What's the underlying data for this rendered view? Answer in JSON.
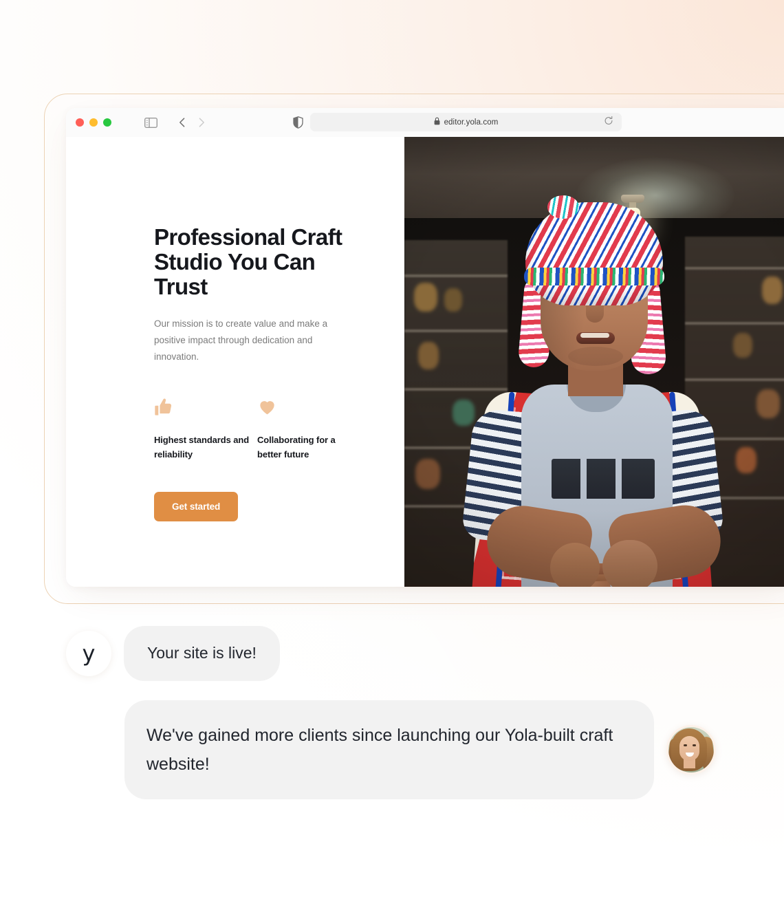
{
  "browser": {
    "traffic_lights": [
      "close",
      "minimize",
      "maximize"
    ],
    "sidebar_icon": "sidebar-toggle-icon",
    "back_icon": "chevron-left-icon",
    "forward_icon": "chevron-right-icon",
    "shield_icon": "shield-icon",
    "lock_icon": "lock-icon",
    "url": "editor.yola.com",
    "reload_icon": "reload-icon"
  },
  "hero": {
    "title": "Professional Craft Studio You Can Trust",
    "subtitle": "Our mission is to create value and make a positive impact through dedication and innovation.",
    "features": [
      {
        "icon": "thumbs-up-icon",
        "label": "Highest standards and reliability"
      },
      {
        "icon": "heart-icon",
        "label": "Collaborating for a better future"
      }
    ],
    "cta_label": "Get started",
    "photo_alt": "Artisan wearing a colorful chullo hat shaping clay on a pottery wheel"
  },
  "chat": {
    "brand_mark": "y",
    "messages": [
      {
        "text": "Your site is live!",
        "sender": "yola"
      },
      {
        "text": "We've gained more clients since launching our Yola-built craft website!",
        "sender": "client"
      }
    ],
    "client_avatar_alt": "Smiling woman with long hair"
  },
  "colors": {
    "accent": "#e08e44",
    "feature_icon": "#f0c39a",
    "bubble_bg": "#f2f2f2",
    "heading": "#16181d",
    "body_text": "#7b7b7b",
    "frame_border": "#ecd2b4"
  }
}
